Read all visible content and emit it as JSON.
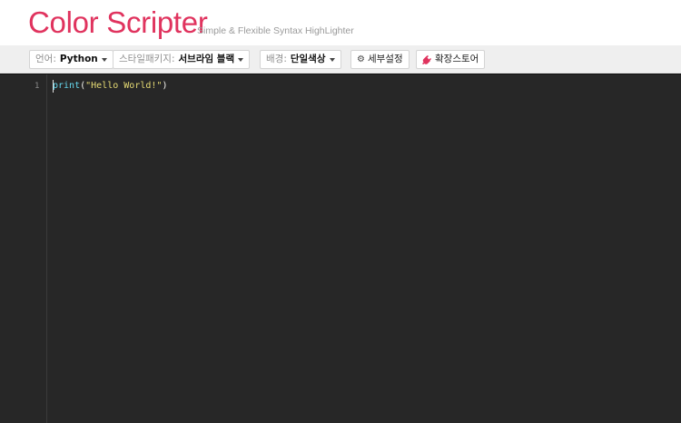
{
  "header": {
    "logo": "Color Scripter",
    "tagline": "Simple & Flexible Syntax HighLighter"
  },
  "toolbar": {
    "language": {
      "label": "언어:",
      "value": "Python"
    },
    "style_package": {
      "label": "스타일패키지:",
      "value": "서브라임 블랙"
    },
    "background": {
      "label": "배경:",
      "value": "단일색상"
    },
    "settings": {
      "label": "세부설정",
      "icon": "gear-icon"
    },
    "extension_store": {
      "label": "확장스토어",
      "icon": "plug-icon"
    }
  },
  "editor": {
    "line_number": "1",
    "code": {
      "fn": "print",
      "open": "(",
      "string": "\"Hello World!\"",
      "close": ")"
    }
  },
  "colors": {
    "brand": "#e0335e",
    "editor_bg": "#272727",
    "keyword": "#66d9ef",
    "string": "#e6db74"
  }
}
